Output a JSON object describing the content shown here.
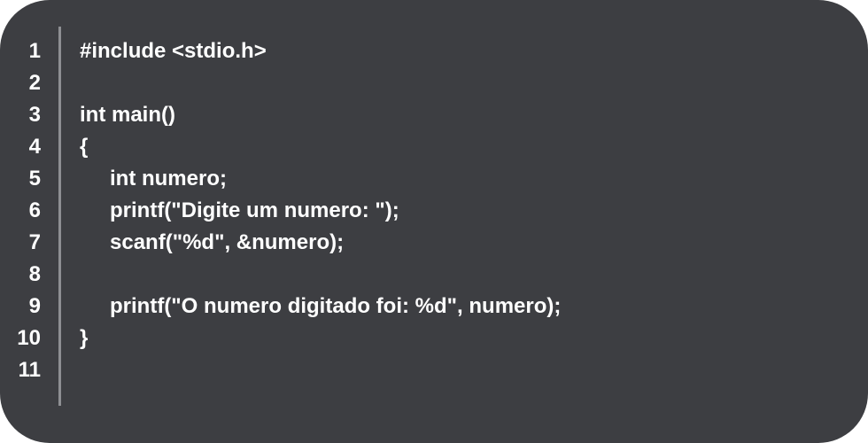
{
  "editor": {
    "line_numbers": [
      "1",
      "2",
      "3",
      "4",
      "5",
      "6",
      "7",
      "8",
      "9",
      "10",
      "11"
    ],
    "lines": [
      {
        "text": "#include <stdio.h>",
        "indent": 0
      },
      {
        "text": "",
        "indent": 0
      },
      {
        "text": "int main()",
        "indent": 0
      },
      {
        "text": "{",
        "indent": 0
      },
      {
        "text": "int numero;",
        "indent": 1
      },
      {
        "text": "printf(\"Digite um numero: \");",
        "indent": 1
      },
      {
        "text": "scanf(\"%d\", &numero);",
        "indent": 1
      },
      {
        "text": "",
        "indent": 0
      },
      {
        "text": "printf(\"O numero digitado foi: %d\", numero);",
        "indent": 1
      },
      {
        "text": "}",
        "indent": 0
      },
      {
        "text": "",
        "indent": 0
      }
    ],
    "colors": {
      "background": "#3d3e42",
      "text": "#ffffff",
      "divider": "#8e8f93"
    }
  }
}
